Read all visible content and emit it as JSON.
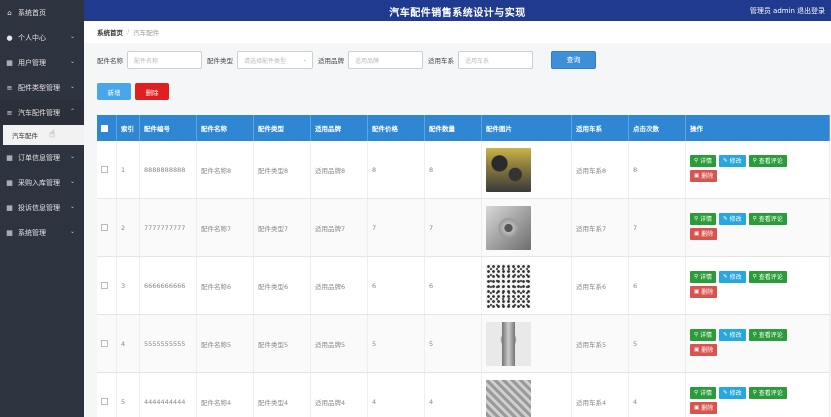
{
  "sidebar": {
    "items": [
      {
        "icon": "home-icon",
        "glyph": "⌂",
        "label": "系统首页",
        "chev": ""
      },
      {
        "icon": "user-icon",
        "glyph": "●",
        "label": "个人中心",
        "chev": "⌄"
      },
      {
        "icon": "grid-icon",
        "glyph": "▦",
        "label": "用户管理",
        "chev": "⌄"
      },
      {
        "icon": "list-icon",
        "glyph": "≡",
        "label": "配件类型管理",
        "chev": "⌄"
      },
      {
        "icon": "list-icon",
        "glyph": "≡",
        "label": "汽车配件管理",
        "chev": "⌃"
      }
    ],
    "sub_active": "汽车配件",
    "items_after": [
      {
        "icon": "grid-icon",
        "glyph": "▦",
        "label": "订单信息管理",
        "chev": "⌄"
      },
      {
        "icon": "grid-icon",
        "glyph": "▦",
        "label": "采购入库管理",
        "chev": "⌄"
      },
      {
        "icon": "grid-icon",
        "glyph": "▦",
        "label": "投诉信息管理",
        "chev": "⌄"
      },
      {
        "icon": "grid-icon",
        "glyph": "▦",
        "label": "系统管理",
        "chev": "⌄"
      }
    ]
  },
  "header": {
    "title": "汽车配件销售系统设计与实现",
    "user": "管理员 admin",
    "logout": "退出登录"
  },
  "breadcrumb": {
    "home": "系统首页",
    "sep": "/",
    "current": "汽车配件"
  },
  "search": {
    "name_label": "配件名称",
    "name_placeholder": "配件名称",
    "type_label": "配件类型",
    "type_placeholder": "请选择配件类型",
    "brand_label": "适用品牌",
    "brand_placeholder": "适用品牌",
    "series_label": "适用车系",
    "series_placeholder": "适用车系",
    "query_button": "查询"
  },
  "actions": {
    "add": "新增",
    "delete": "删除"
  },
  "table": {
    "headers": [
      "",
      "索引",
      "配件编号",
      "配件名称",
      "配件类型",
      "适用品牌",
      "配件价格",
      "配件数量",
      "配件图片",
      "适用车系",
      "点击次数",
      "操作"
    ],
    "rows": [
      {
        "idx": "1",
        "code": "8888888888",
        "name": "配件名称8",
        "type": "配件类型8",
        "brand": "适用品牌8",
        "price": "8",
        "qty": "8",
        "series": "适用车系8",
        "clicks": "8"
      },
      {
        "idx": "2",
        "code": "7777777777",
        "name": "配件名称7",
        "type": "配件类型7",
        "brand": "适用品牌7",
        "price": "7",
        "qty": "7",
        "series": "适用车系7",
        "clicks": "7"
      },
      {
        "idx": "3",
        "code": "6666666666",
        "name": "配件名称6",
        "type": "配件类型6",
        "brand": "适用品牌6",
        "price": "6",
        "qty": "6",
        "series": "适用车系6",
        "clicks": "6"
      },
      {
        "idx": "4",
        "code": "5555555555",
        "name": "配件名称5",
        "type": "配件类型5",
        "brand": "适用品牌5",
        "price": "5",
        "qty": "5",
        "series": "适用车系5",
        "clicks": "5"
      },
      {
        "idx": "5",
        "code": "4444444444",
        "name": "配件名称4",
        "type": "配件类型4",
        "brand": "适用品牌4",
        "price": "4",
        "qty": "4",
        "series": "适用车系4",
        "clicks": "4"
      }
    ],
    "ops": {
      "detail": "详情",
      "edit": "修改",
      "review": "查看评论",
      "remove": "删除"
    }
  },
  "colors": {
    "header": "#1f3a8e",
    "sidebar": "#2e3340",
    "table_header": "#2f87d4",
    "query": "#3e8ed8",
    "add": "#48a7ea",
    "delete": "#e02020",
    "detail": "#2c9c3b",
    "edit": "#27a6e0",
    "remove": "#d9534f"
  }
}
